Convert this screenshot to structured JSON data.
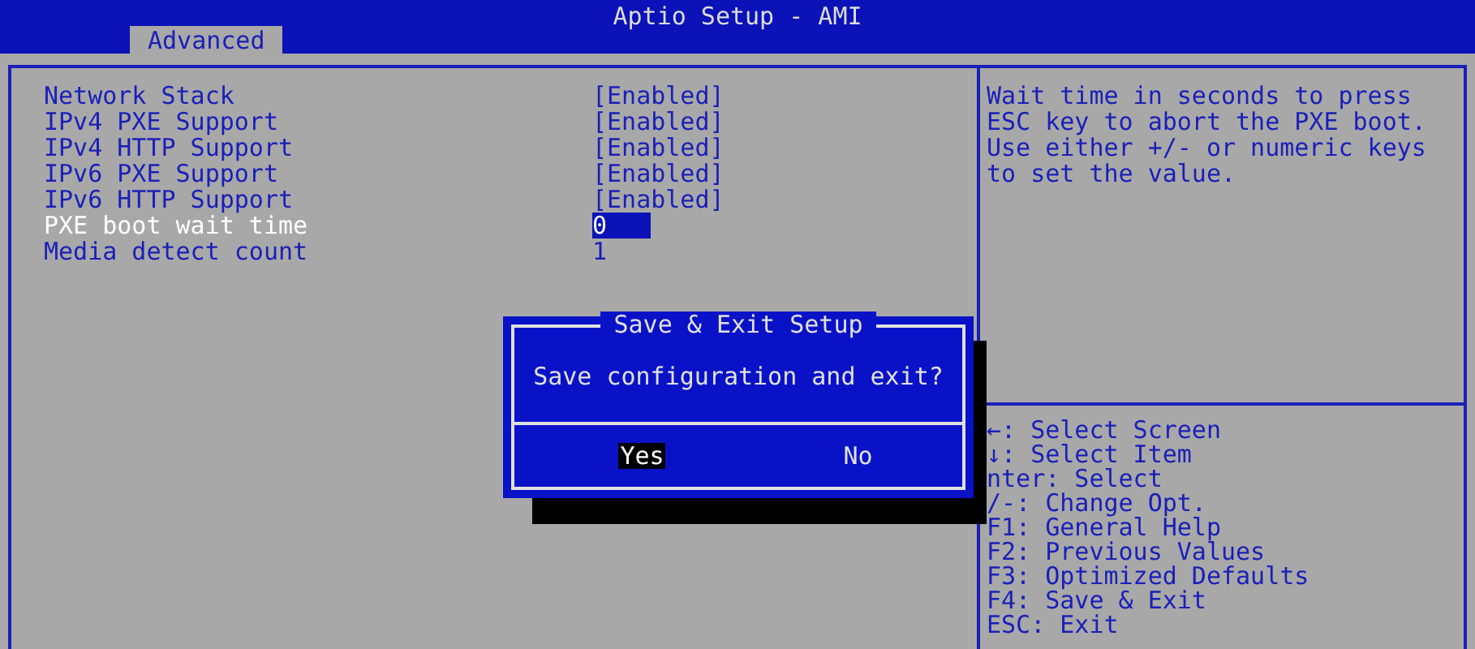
{
  "window": {
    "title": "Aptio Setup - AMI"
  },
  "tabs": [
    {
      "label": "Advanced",
      "selected": true
    }
  ],
  "settings": [
    {
      "label": "Network Stack",
      "value": "[Enabled]",
      "selected": false
    },
    {
      "label": "IPv4 PXE Support",
      "value": "[Enabled]",
      "selected": false
    },
    {
      "label": "IPv4 HTTP Support",
      "value": "[Enabled]",
      "selected": false
    },
    {
      "label": "IPv6 PXE Support",
      "value": "[Enabled]",
      "selected": false
    },
    {
      "label": "IPv6 HTTP Support",
      "value": "[Enabled]",
      "selected": false
    },
    {
      "label": "PXE boot wait time",
      "value": "0",
      "selected": true
    },
    {
      "label": "Media detect count",
      "value": "1",
      "selected": false
    }
  ],
  "help_text": "Wait time in seconds to press ESC key to abort the PXE boot. Use either +/- or numeric keys to set the value.",
  "key_help": [
    "←: Select Screen",
    "↓: Select Item",
    "nter: Select",
    "/-: Change Opt.",
    "F1: General Help",
    "F2: Previous Values",
    "F3: Optimized Defaults",
    "F4: Save & Exit",
    "ESC: Exit"
  ],
  "dialog": {
    "title": "Save & Exit Setup",
    "message": "Save configuration and exit?",
    "buttons": [
      {
        "label": "Yes",
        "selected": true
      },
      {
        "label": "No",
        "selected": false
      }
    ]
  }
}
